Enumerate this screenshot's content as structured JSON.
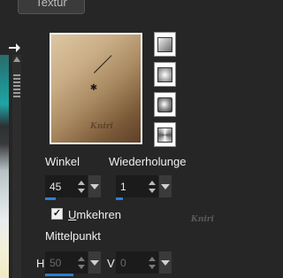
{
  "tab": {
    "label": "Textur"
  },
  "angle": {
    "label": "Winkel",
    "value": "45"
  },
  "repeats": {
    "label": "Wiederholunge",
    "value": "1"
  },
  "invert": {
    "label_prefix": "",
    "label_underlined": "U",
    "label_rest": "mkehren",
    "checked": true
  },
  "center": {
    "label": "Mittelpunkt",
    "h_label": "H",
    "h_value": "50",
    "v_label": "V",
    "v_value": "0"
  },
  "watermark": "Kniri",
  "colors": {
    "background": "#262626",
    "accent": "#2f7fd1",
    "gradient_light": "#ddc7a3",
    "gradient_dark": "#5e4027"
  },
  "icons": {
    "arrow": "right-arrow-icon",
    "styles": [
      "linear-gradient-style-icon",
      "rectangular-gradient-style-icon",
      "radial-gradient-style-icon",
      "sunburst-gradient-style-icon"
    ]
  }
}
